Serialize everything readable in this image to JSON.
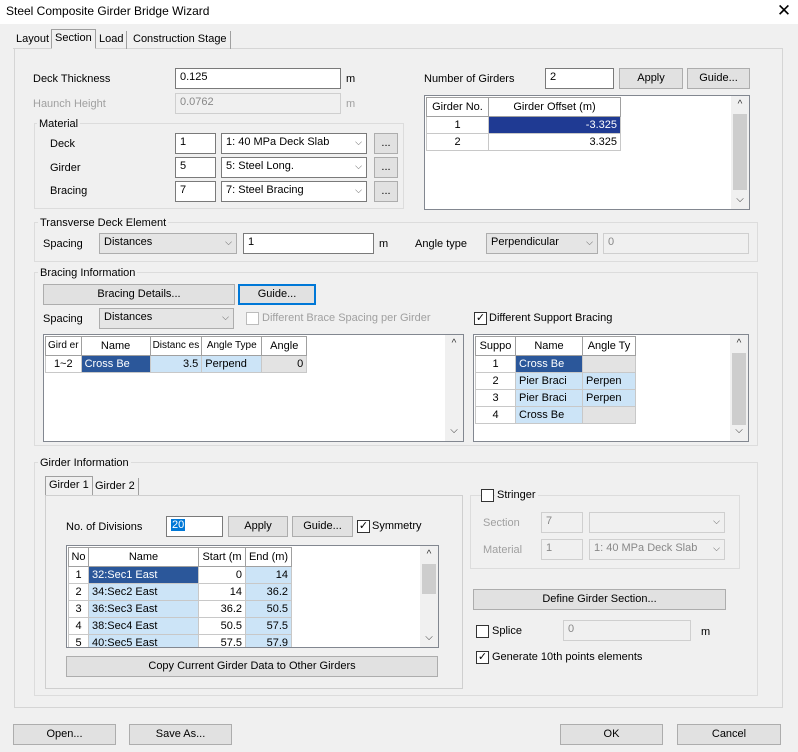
{
  "window": {
    "title": "Steel Composite Girder Bridge Wizard",
    "close_glyph": "✕"
  },
  "tabs": [
    "Layout",
    "Section",
    "Load",
    "Construction Stage"
  ],
  "deck": {
    "thickness_label": "Deck Thickness",
    "thickness_value": "0.125",
    "thickness_unit": "m",
    "haunch_label": "Haunch Height",
    "haunch_value": "0.0762",
    "haunch_unit": "m"
  },
  "material": {
    "group_label": "Material",
    "rows": [
      {
        "label": "Deck",
        "id": "1",
        "option": "1: 40 MPa Deck Slab"
      },
      {
        "label": "Girder",
        "id": "5",
        "option": "5: Steel Long."
      },
      {
        "label": "Bracing",
        "id": "7",
        "option": "7: Steel Bracing"
      }
    ],
    "ellipsis": "..."
  },
  "girders": {
    "count_label": "Number of Girders",
    "count_value": "2",
    "apply_label": "Apply",
    "guide_label": "Guide...",
    "headers": [
      "Girder No.",
      "Girder Offset (m)"
    ],
    "rows": [
      {
        "no": "1",
        "offset": "-3.325"
      },
      {
        "no": "2",
        "offset": "3.325"
      }
    ]
  },
  "transverse": {
    "group_label": "Transverse Deck Element",
    "spacing_label": "Spacing",
    "spacing_option": "Distances",
    "spacing_value": "1",
    "spacing_unit": "m",
    "angle_label": "Angle type",
    "angle_option": "Perpendicular",
    "angle_value": "0"
  },
  "bracing": {
    "group_label": "Bracing Information",
    "details_label": "Bracing Details...",
    "guide_label": "Guide...",
    "spacing_label": "Spacing",
    "spacing_option": "Distances",
    "diff_spacing_label": "Different Brace Spacing per Girder",
    "diff_support_label": "Different Support Bracing",
    "headers": [
      "Gird er",
      "Name",
      "Distanc es",
      "Angle Type",
      "Angle"
    ],
    "rows": [
      {
        "girder": "1~2",
        "name": "Cross Be",
        "distance": "3.5",
        "angle_type": "Perpend",
        "angle": "0"
      }
    ],
    "support_headers": [
      "Suppo",
      "Name",
      "Angle Ty"
    ],
    "support_rows": [
      {
        "no": "1",
        "name": "Cross Be",
        "angle_type": ""
      },
      {
        "no": "2",
        "name": "Pier Braci",
        "angle_type": "Perpen"
      },
      {
        "no": "3",
        "name": "Pier Braci",
        "angle_type": "Perpen"
      },
      {
        "no": "4",
        "name": "Cross Be",
        "angle_type": ""
      }
    ]
  },
  "girder_info": {
    "group_label": "Girder Information",
    "tabs": [
      "Girder 1",
      "Girder 2"
    ],
    "divisions_label": "No. of Divisions",
    "divisions_value": "20",
    "apply_label": "Apply",
    "guide_label": "Guide...",
    "symmetry_label": "Symmetry",
    "headers": [
      "No",
      "Name",
      "Start (m",
      "End (m)"
    ],
    "rows": [
      {
        "no": "1",
        "name": "32:Sec1 East",
        "start": "0",
        "end": "14"
      },
      {
        "no": "2",
        "name": "34:Sec2 East",
        "start": "14",
        "end": "36.2"
      },
      {
        "no": "3",
        "name": "36:Sec3 East",
        "start": "36.2",
        "end": "50.5"
      },
      {
        "no": "4",
        "name": "38:Sec4 East",
        "start": "50.5",
        "end": "57.5"
      },
      {
        "no": "5",
        "name": "40:Sec5 East",
        "start": "57.5",
        "end": "57.9"
      }
    ],
    "copy_label": "Copy Current Girder Data to Other Girders"
  },
  "stringer": {
    "label": "Stringer",
    "section_label": "Section",
    "section_value": "7",
    "material_label": "Material",
    "material_value": "1",
    "material_option": "1: 40 MPa Deck Slab"
  },
  "define_label": "Define Girder Section...",
  "splice": {
    "label": "Splice",
    "value": "0",
    "unit": "m"
  },
  "generate_label": "Generate 10th points elements",
  "footer": {
    "open": "Open...",
    "save_as": "Save As...",
    "ok": "OK",
    "cancel": "Cancel"
  },
  "icons": {
    "check": "✓",
    "chevron_down": "⌵",
    "scroll_up": "^",
    "scroll_down": "⌵"
  }
}
